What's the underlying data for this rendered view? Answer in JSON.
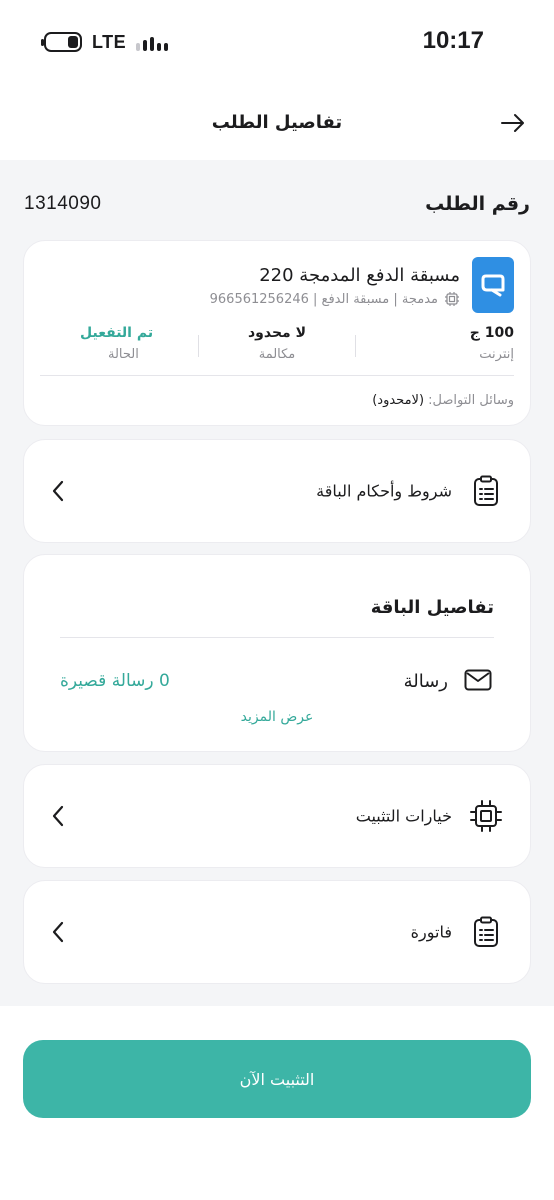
{
  "status_bar": {
    "network": "LTE",
    "time": "10:17"
  },
  "header": {
    "title": "تفاصيل الطلب"
  },
  "order": {
    "label": "رقم الطلب",
    "number": "1314090"
  },
  "plan": {
    "name": "مسبقة الدفع المدمجة 220",
    "subtitle": "مدمجة | مسبقة الدفع | 966561256246",
    "brand_color": "#2f8fe3",
    "stats": [
      {
        "value": "100 ج",
        "label": "إنترنت"
      },
      {
        "value": "لا محدود",
        "label": "مكالمة"
      },
      {
        "value": "تم التفعيل",
        "label": "الحالة"
      }
    ],
    "channels_label": "وسائل التواصل:",
    "channels_value": "(لامحدود)"
  },
  "terms": {
    "label": "شروط وأحكام الباقة"
  },
  "package_details": {
    "title": "تفاصيل الباقة",
    "message_label": "رسالة",
    "message_value": "0 رسالة قصيرة",
    "more_link": "عرض المزيد"
  },
  "install_options": {
    "label": "خيارات التثبيت"
  },
  "invoice": {
    "label": "فاتورة"
  },
  "install_button": {
    "label": "التثبيت الآن"
  },
  "colors": {
    "accent": "#3db5a7",
    "accent_text": "#34a99a"
  }
}
